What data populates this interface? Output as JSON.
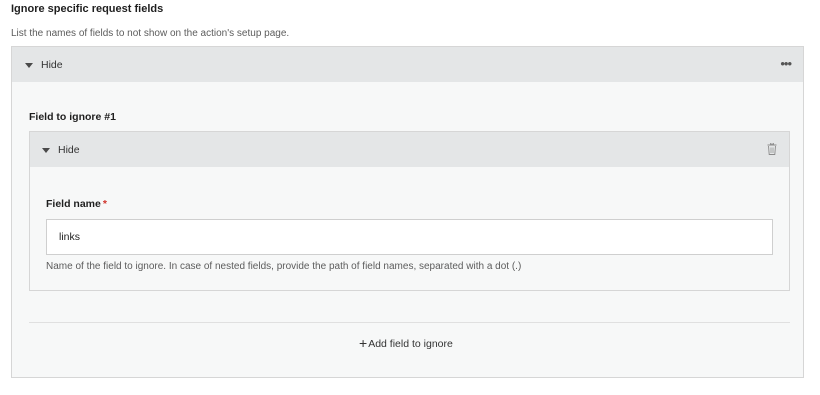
{
  "section": {
    "title": "Ignore specific request fields",
    "description": "List the names of fields to not show on the action's setup page."
  },
  "outer_panel": {
    "toggle_label": "Hide",
    "more_icon": "more-horizontal-icon"
  },
  "field_item": {
    "title": "Field to ignore #1",
    "toggle_label": "Hide",
    "delete_icon": "trash-icon",
    "field_name_label": "Field name",
    "required_marker": "*",
    "field_name_value": "links",
    "help_text": "Name of the field to ignore. In case of nested fields, provide the path of field names, separated with a dot (.)"
  },
  "add_button": {
    "icon": "+",
    "label": "Add field to ignore"
  },
  "colors": {
    "header_bg": "#e4e6e7",
    "panel_bg": "#f7f8f8",
    "required": "#d0342c"
  }
}
